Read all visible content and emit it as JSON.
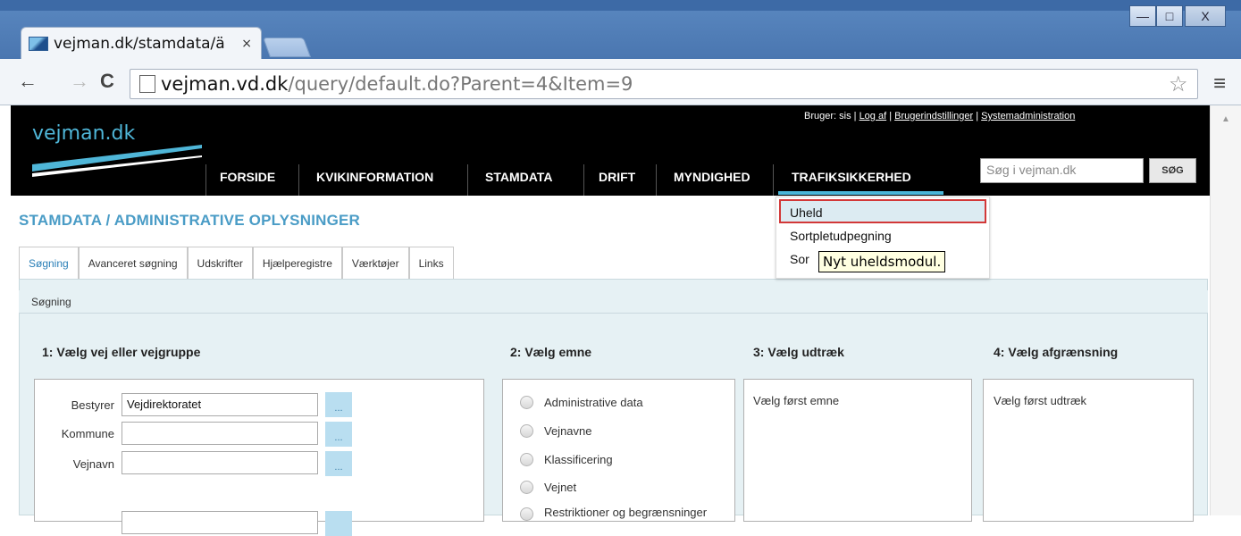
{
  "browser": {
    "tab_title": "vejman.dk/stamdata/ä",
    "tab_close": "×",
    "url_host": "vejman.vd.dk",
    "url_path": "/query/default.do?Parent=4&Item=9",
    "back": "←",
    "forward": "→",
    "reload": "C",
    "star": "☆",
    "menu": "≡",
    "min": "—",
    "max": "□",
    "close": "X"
  },
  "site": {
    "logo": "vejman.dk",
    "user_prefix": "Bruger: sis |",
    "logout": "Log af",
    "settings": "Brugerindstillinger",
    "sysadmin": "Systemadministration",
    "sep": "|",
    "nav": [
      "FORSIDE",
      "KVIKINFORMATION",
      "STAMDATA",
      "DRIFT",
      "MYNDIGHED",
      "TRAFIKSIKKERHED"
    ],
    "search_placeholder": "Søg i vejman.dk",
    "search_button": "SØG"
  },
  "dropdown": {
    "items": [
      "Uheld",
      "Sortpletudpegning",
      "Sor"
    ],
    "tooltip": "Nyt uheldsmodul."
  },
  "page": {
    "title": "STAMDATA / ADMINISTRATIVE OPLYSNINGER",
    "tabs": [
      "Søgning",
      "Avanceret søgning",
      "Udskrifter",
      "Hjælperegistre",
      "Værktøjer",
      "Links"
    ],
    "panel_title": "Søgning",
    "step1": "1: Vælg vej eller vejgruppe",
    "step2": "2: Vælg emne",
    "step3": "3: Vælg udtræk",
    "step4": "4: Vælg afgrænsning",
    "fields": [
      {
        "label": "Bestyrer",
        "value": "Vejdirektoratet"
      },
      {
        "label": "Kommune",
        "value": ""
      },
      {
        "label": "Vejnavn",
        "value": ""
      }
    ],
    "dots": "...",
    "topics": [
      "Administrative data",
      "Vejnavne",
      "Klassificering",
      "Vejnet",
      "Restriktioner og begrænsninger"
    ],
    "step3_hint": "Vælg først emne",
    "step4_hint": "Vælg først udtræk"
  }
}
